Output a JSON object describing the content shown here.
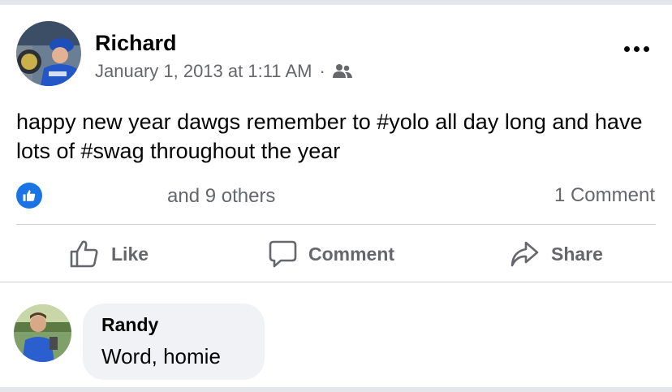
{
  "post": {
    "author": "Richard",
    "timestamp": "January 1, 2013 at 1:11 AM",
    "separator": "·",
    "audience_icon": "friends-icon",
    "more_icon": "more-options-icon",
    "text": "happy new year dawgs remember to #yolo all day long and have lots of #swag throughout the year"
  },
  "reactions": {
    "icon": "like-reaction-icon",
    "text": "and 9 others",
    "comments_count": "1 Comment"
  },
  "actions": [
    {
      "label": "Like",
      "icon": "thumbs-up-icon"
    },
    {
      "label": "Comment",
      "icon": "comment-bubble-icon"
    },
    {
      "label": "Share",
      "icon": "share-arrow-icon"
    }
  ],
  "comment": {
    "author": "Randy",
    "text": "Word, homie"
  },
  "colors": {
    "accent": "#1b74e4",
    "secondary_text": "#65676b",
    "bubble": "#f0f2f5",
    "divider": "#ced0d4"
  }
}
